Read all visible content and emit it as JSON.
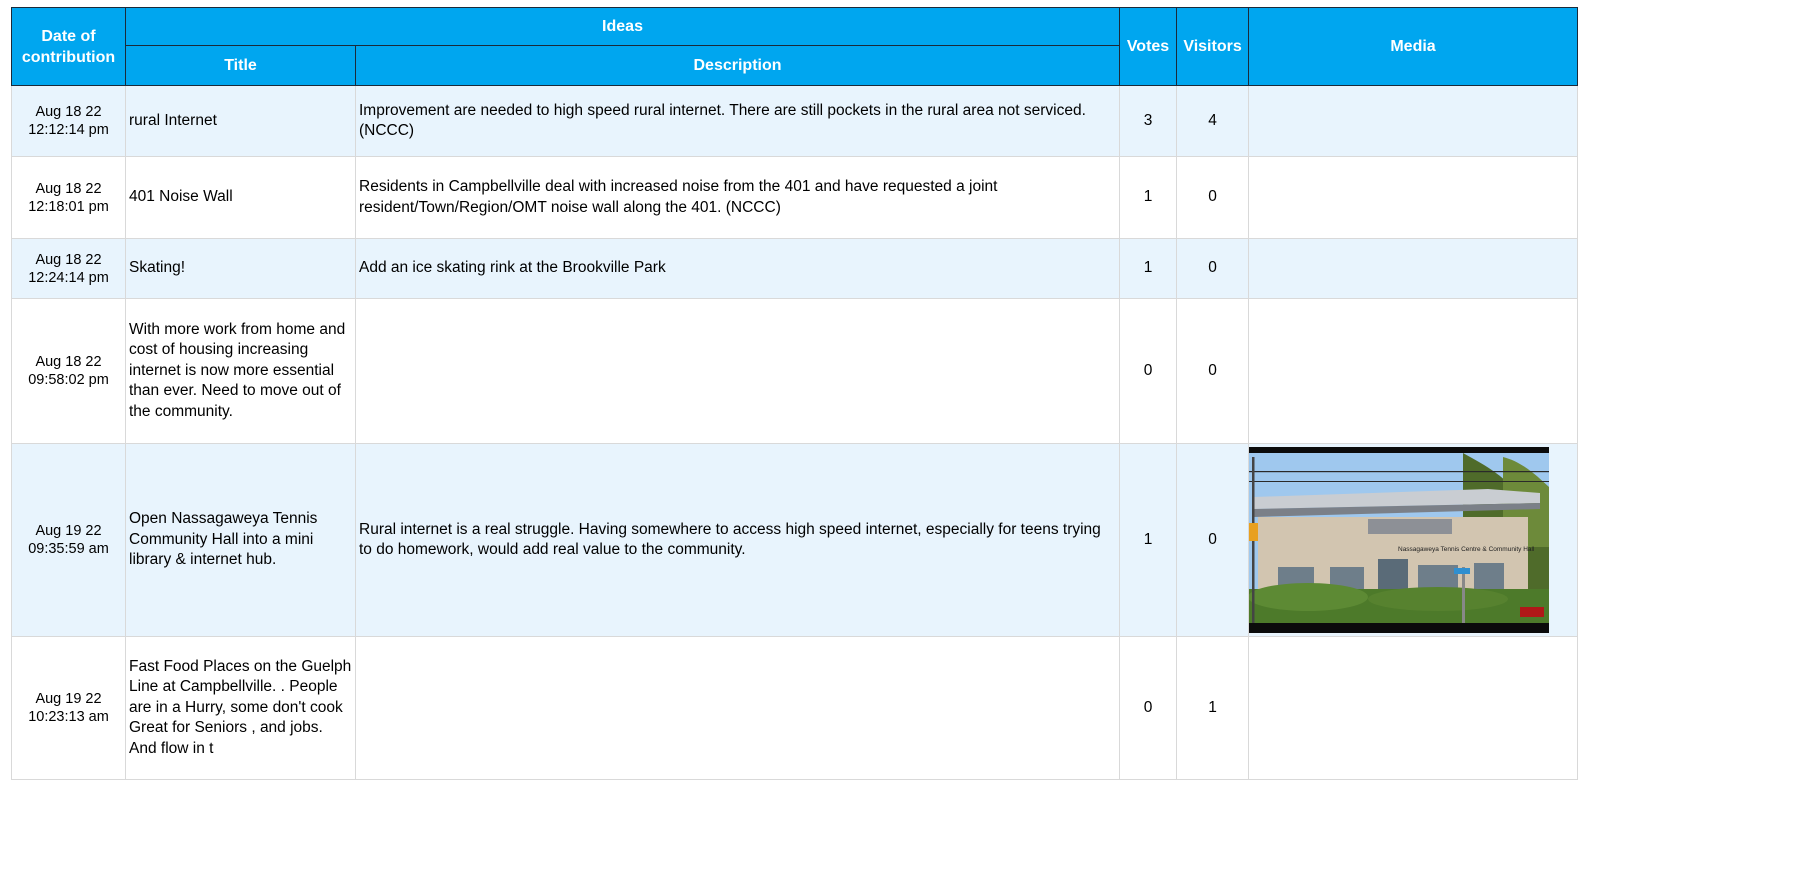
{
  "headers": {
    "date": "Date of contribution",
    "ideas": "Ideas",
    "title": "Title",
    "description": "Description",
    "votes": "Votes",
    "visitors": "Visitors",
    "media": "Media"
  },
  "rows": [
    {
      "date": "Aug 18 22",
      "time": "12:12:14 pm",
      "title": "rural Internet",
      "description": "Improvement are needed to high speed rural internet.  There are still pockets in the rural area not serviced.  (NCCC)",
      "votes": "3",
      "visitors": "4"
    },
    {
      "date": "Aug 18 22",
      "time": "12:18:01 pm",
      "title": "401 Noise Wall",
      "description": "Residents in Campbellville deal with increased noise from the 401 and have requested a joint resident/Town/Region/OMT noise wall along the 401. (NCCC)",
      "votes": "1",
      "visitors": "0"
    },
    {
      "date": "Aug 18 22",
      "time": "12:24:14 pm",
      "title": "Skating!",
      "description": "Add an ice skating rink at the Brookville Park",
      "votes": "1",
      "visitors": "0"
    },
    {
      "date": "Aug 18 22",
      "time": "09:58:02 pm",
      "title": "With more work from home and cost of housing increasing internet is now more essential than ever. Need to move out of the community.",
      "description": "",
      "votes": "0",
      "visitors": "0"
    },
    {
      "date": "Aug 19 22",
      "time": "09:35:59 am",
      "title": "Open Nassagaweya Tennis Community Hall into a mini library & internet hub.",
      "description": "Rural internet is a real struggle. Having somewhere to access high speed internet, especially for teens trying to do homework, would add real value to the community.",
      "votes": "1",
      "visitors": "0",
      "media_sign": "Nassagaweya Tennis Centre & Community Hall"
    },
    {
      "date": "Aug 19 22",
      "time": "10:23:13 am",
      "title": "Fast Food Places on the Guelph Line at Campbellville. . People are in a Hurry, some don't cook Great for Seniors , and jobs. And flow in t",
      "description": "",
      "votes": "0",
      "visitors": "1"
    }
  ],
  "colors": {
    "header_bg": "#00a6ef",
    "header_text": "#ffffff",
    "row_alt_bg": "#e8f4fd"
  }
}
